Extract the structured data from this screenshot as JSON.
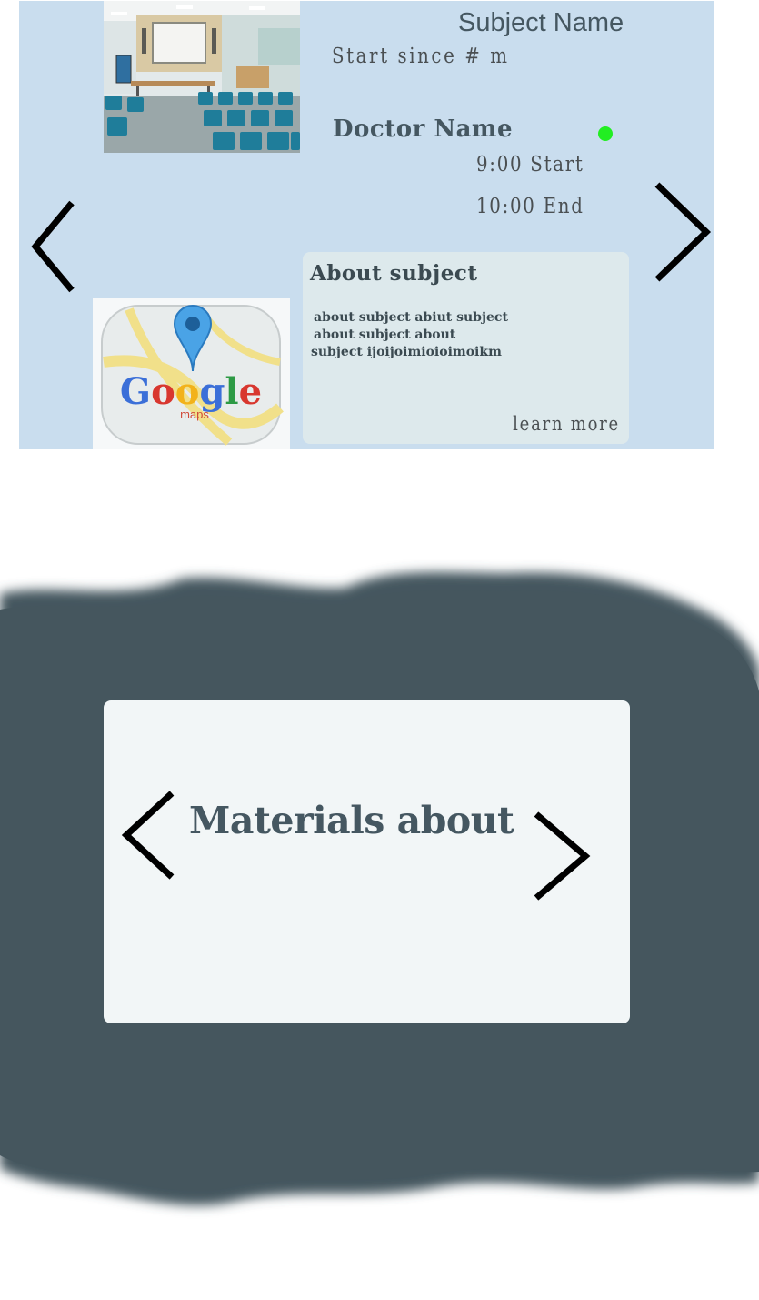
{
  "subject": {
    "name": "Subject Name",
    "start_since": "Start since # m",
    "doctor_name": "Doctor Name",
    "doctor_status_color": "#22ee22",
    "start_time": "9:00 Start",
    "end_time": "10:00 End",
    "photo_icon": "classroom-photo",
    "map_icon": "google-maps-icon",
    "map_logo_text": "Google",
    "map_logo_subtext": "maps"
  },
  "about": {
    "title": "About subject",
    "lines": [
      "about subject abiut subject",
      "about subject about",
      "subject ijoijoimioioimoikm"
    ],
    "learn_more": "learn more"
  },
  "materials": {
    "title": "Materials about"
  },
  "colors": {
    "card_bg": "#c9ddee",
    "about_bg": "#dde9ec",
    "band_bg": "#45565e",
    "materials_card_bg": "#f2f6f7",
    "text_dark": "#455761"
  }
}
